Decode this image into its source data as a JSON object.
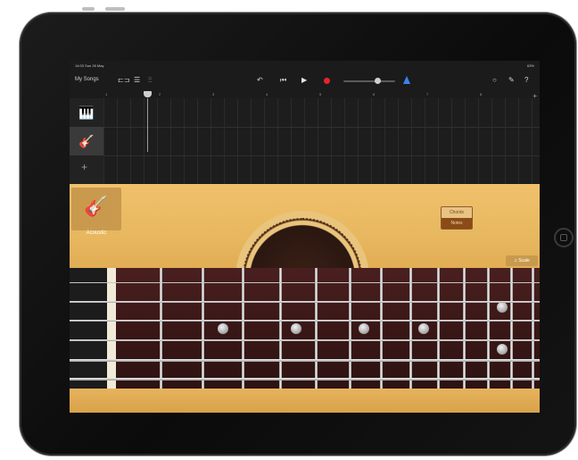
{
  "status": {
    "time": "14:03 Sun 26 May",
    "battery": "63%"
  },
  "toolbar": {
    "my_songs": "My Songs"
  },
  "ruler": {
    "bars": [
      "1",
      "2",
      "3",
      "4",
      "5",
      "6",
      "7",
      "8"
    ]
  },
  "instrument": {
    "name": "Acoustic"
  },
  "mode_toggle": {
    "chords_label": "Chords",
    "notes_label": "Notes",
    "selected": "Notes"
  },
  "scale_button": {
    "label": "Scale"
  },
  "colors": {
    "record": "#e0262a",
    "metronome": "#3a84f0",
    "guitar_body": "#e8b860",
    "fretboard": "#3a1717",
    "toggle_selected": "#8a4b18"
  }
}
